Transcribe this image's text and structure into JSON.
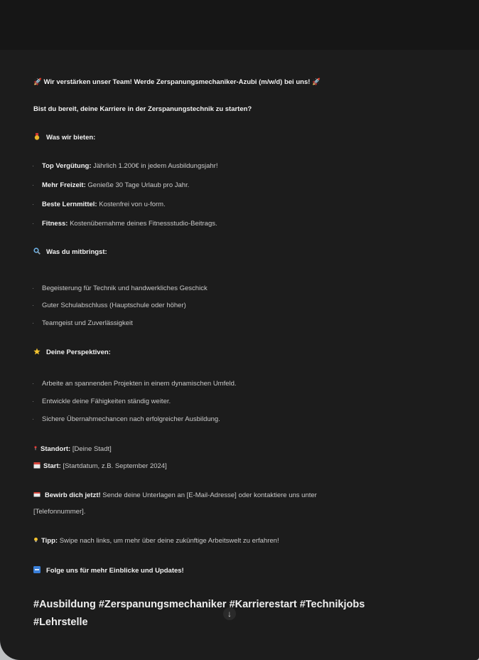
{
  "post": {
    "headline": "Wir verstärken unser Team! Werde Zerspanungsmechaniker-Azubi (m/w/d) bei uns!",
    "headline_icon": "rocket-icon",
    "intro": "Bist du bereit, deine Karriere in der Zerspanungstechnik zu starten?",
    "offer": {
      "icon": "medal-icon",
      "heading": "Was wir bieten:",
      "items": [
        {
          "label": "Top Vergütung:",
          "text": "Jährlich 1.200€ in jedem Ausbildungsjahr!"
        },
        {
          "label": "Mehr Freizeit:",
          "text": "Genieße 30 Tage Urlaub pro Jahr."
        },
        {
          "label": "Beste Lernmittel:",
          "text": "Kostenfrei von u-form."
        },
        {
          "label": "Fitness:",
          "text": "Kostenübernahme deines Fitnessstudio-Beitrags."
        }
      ]
    },
    "requirements": {
      "icon": "magnifier-icon",
      "heading": "Was du mitbringst:",
      "items": [
        "Begeisterung für Technik und handwerkliches Geschick",
        "Guter Schulabschluss (Hauptschule oder höher)",
        "Teamgeist und Zuverlässigkeit"
      ]
    },
    "perspectives": {
      "icon": "star-icon",
      "heading": "Deine Perspektiven:",
      "items": [
        "Arbeite an spannenden Projekten in einem dynamischen Umfeld.",
        "Entwickle deine Fähigkeiten ständig weiter.",
        "Sichere Übernahmechancen nach erfolgreicher Ausbildung."
      ]
    },
    "location": {
      "icon": "pin-icon",
      "label": "Standort:",
      "text": "[Deine Stadt]"
    },
    "start": {
      "icon": "calendar-icon",
      "label": "Start:",
      "text": "[Startdatum, z.B. September 2024]"
    },
    "apply": {
      "icon": "envelope-icon",
      "label": "Bewirb dich jetzt!",
      "text_line1": "Sende deine Unterlagen an [E-Mail-Adresse] oder kontaktiere uns unter",
      "text_line2": "[Telefonnummer]."
    },
    "tip": {
      "icon": "lightbulb-icon",
      "label": "Tipp:",
      "text": "Swipe nach links, um mehr über deine zukünftige Arbeitswelt zu erfahren!"
    },
    "follow": {
      "icon": "arrow-right-icon",
      "text": "Folge uns für mehr Einblicke und Updates!"
    },
    "hashtags_line1": "#Ausbildung #Zerspanungsmechaniker #Karrierestart #Technikjobs",
    "hashtags_line2": "#Lehrstelle"
  },
  "colors": {
    "background": "#1c1c1c",
    "text": "#c9c9c9",
    "bold": "#f2f2f2",
    "medal": "#e7b52a",
    "magnifier": "#6fb3e8",
    "star": "#f2c230",
    "pin": "#e0322e",
    "follow": "#3a7fd9"
  }
}
